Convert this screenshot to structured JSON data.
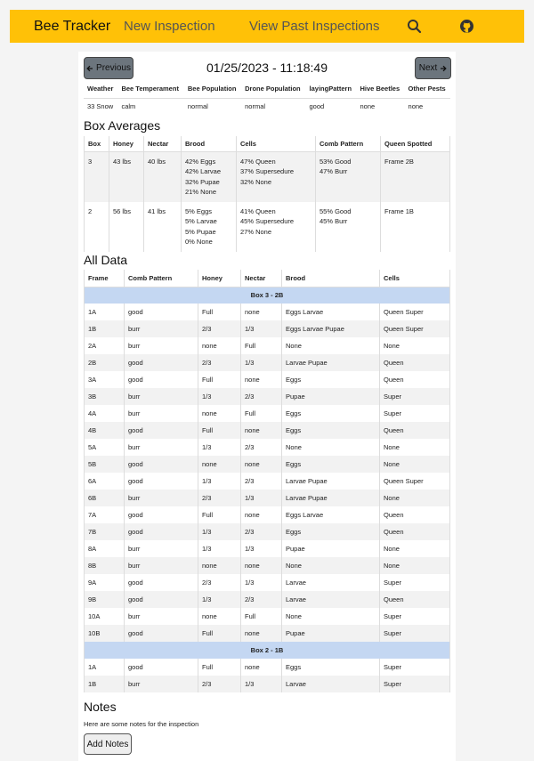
{
  "nav": {
    "brand": "Bee Tracker",
    "new_inspection": "New Inspection",
    "view_past": "View Past Inspections",
    "search_icon": "search-icon",
    "github_icon": "github-icon"
  },
  "header": {
    "prev_label": "Previous",
    "next_label": "Next",
    "date": "01/25/2023 - 11:18:49"
  },
  "info": {
    "headers": [
      "Weather",
      "Bee Temperament",
      "Bee Population",
      "Drone Population",
      "layingPattern",
      "Hive Beetles",
      "Other Pests"
    ],
    "values": [
      "33 Snow",
      "calm",
      "normal",
      "normal",
      "good",
      "none",
      "none"
    ]
  },
  "box_averages": {
    "title": "Box Averages",
    "headers": [
      "Box",
      "Honey",
      "Nectar",
      "Brood",
      "Cells",
      "Comb Pattern",
      "Queen Spotted"
    ],
    "rows": [
      {
        "box": "3",
        "honey": "43 lbs",
        "nectar": "40 lbs",
        "brood": [
          "42% Eggs",
          "42% Larvae",
          "32% Pupae",
          "21% None"
        ],
        "cells": [
          "47% Queen",
          "37% Supersedure",
          "32% None"
        ],
        "comb": [
          "53% Good",
          "47% Burr"
        ],
        "queen": "Frame 2B"
      },
      {
        "box": "2",
        "honey": "56 lbs",
        "nectar": "41 lbs",
        "brood": [
          "5% Eggs",
          "5% Larvae",
          "5% Pupae",
          "0% None"
        ],
        "cells": [
          "41% Queen",
          "45% Supersedure",
          "27% None"
        ],
        "comb": [
          "55% Good",
          "45% Burr"
        ],
        "queen": "Frame 1B"
      }
    ]
  },
  "all_data": {
    "title": "All Data",
    "headers": [
      "Frame",
      "Comb Pattern",
      "Honey",
      "Nectar",
      "Brood",
      "Cells"
    ],
    "box3_label": "Box 3 - 2B",
    "box3_rows": [
      [
        "1A",
        "good",
        "Full",
        "none",
        "Eggs Larvae",
        "Queen Super"
      ],
      [
        "1B",
        "burr",
        "2/3",
        "1/3",
        "Eggs Larvae Pupae",
        "Queen Super"
      ],
      [
        "2A",
        "burr",
        "none",
        "Full",
        "None",
        "None"
      ],
      [
        "2B",
        "good",
        "2/3",
        "1/3",
        "Larvae Pupae",
        "Queen"
      ],
      [
        "3A",
        "good",
        "Full",
        "none",
        "Eggs",
        "Queen"
      ],
      [
        "3B",
        "burr",
        "1/3",
        "2/3",
        "Pupae",
        "Super"
      ],
      [
        "4A",
        "burr",
        "none",
        "Full",
        "Eggs",
        "Super"
      ],
      [
        "4B",
        "good",
        "Full",
        "none",
        "Eggs",
        "Queen"
      ],
      [
        "5A",
        "burr",
        "1/3",
        "2/3",
        "None",
        "None"
      ],
      [
        "5B",
        "good",
        "none",
        "none",
        "Eggs",
        "None"
      ],
      [
        "6A",
        "good",
        "1/3",
        "2/3",
        "Larvae Pupae",
        "Queen Super"
      ],
      [
        "6B",
        "burr",
        "2/3",
        "1/3",
        "Larvae Pupae",
        "None"
      ],
      [
        "7A",
        "good",
        "Full",
        "none",
        "Eggs Larvae",
        "Queen"
      ],
      [
        "7B",
        "good",
        "1/3",
        "2/3",
        "Eggs",
        "Queen"
      ],
      [
        "8A",
        "burr",
        "1/3",
        "1/3",
        "Pupae",
        "None"
      ],
      [
        "8B",
        "burr",
        "none",
        "none",
        "None",
        "None"
      ],
      [
        "9A",
        "good",
        "2/3",
        "1/3",
        "Larvae",
        "Super"
      ],
      [
        "9B",
        "good",
        "1/3",
        "2/3",
        "Larvae",
        "Queen"
      ],
      [
        "10A",
        "burr",
        "none",
        "Full",
        "None",
        "Super"
      ],
      [
        "10B",
        "good",
        "Full",
        "none",
        "Pupae",
        "Super"
      ]
    ],
    "box2_label": "Box 2 - 1B",
    "box2_rows": [
      [
        "1A",
        "good",
        "Full",
        "none",
        "Eggs",
        "Super"
      ],
      [
        "1B",
        "burr",
        "2/3",
        "1/3",
        "Larvae",
        "Super"
      ]
    ]
  },
  "notes": {
    "title": "Notes",
    "text": "Here are some notes for the inspection",
    "add_label": "Add Notes"
  },
  "colors": {
    "navbar": "#ffc107",
    "box_header": "#c4d7f2",
    "button": "#6c757d"
  }
}
